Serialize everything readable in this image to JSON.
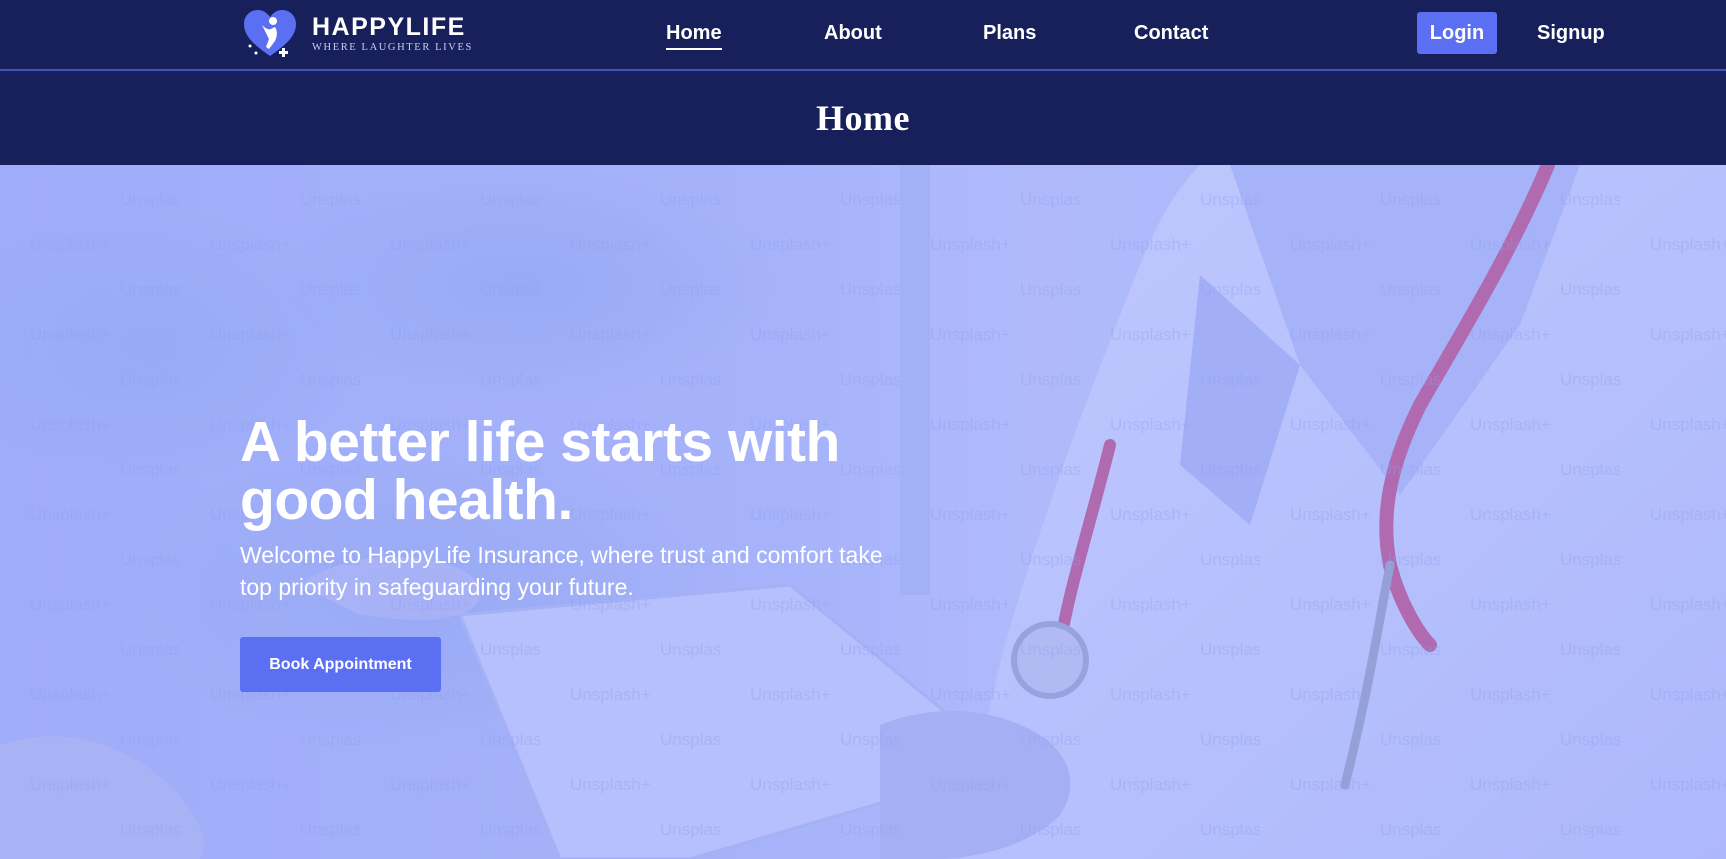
{
  "brand": {
    "name": "HAPPYLIFE",
    "tagline": "WHERE LAUGHTER LIVES",
    "logo_icon": "heart-person-icon"
  },
  "nav": {
    "links": [
      {
        "label": "Home",
        "active": true
      },
      {
        "label": "About",
        "active": false
      },
      {
        "label": "Plans",
        "active": false
      },
      {
        "label": "Contact",
        "active": false
      }
    ],
    "login_label": "Login",
    "signup_label": "Signup"
  },
  "page": {
    "title": "Home"
  },
  "hero": {
    "heading_line1": "A better life starts with",
    "heading_line2": "good health.",
    "subtitle": "Welcome to HappyLife Insurance, where trust and comfort take top priority in safeguarding your future.",
    "cta_label": "Book Appointment",
    "watermark_text": "Unsplash+"
  },
  "colors": {
    "navy": "#17205a",
    "accent": "#5b6ff2",
    "hero_tint": "#aab4f5"
  }
}
